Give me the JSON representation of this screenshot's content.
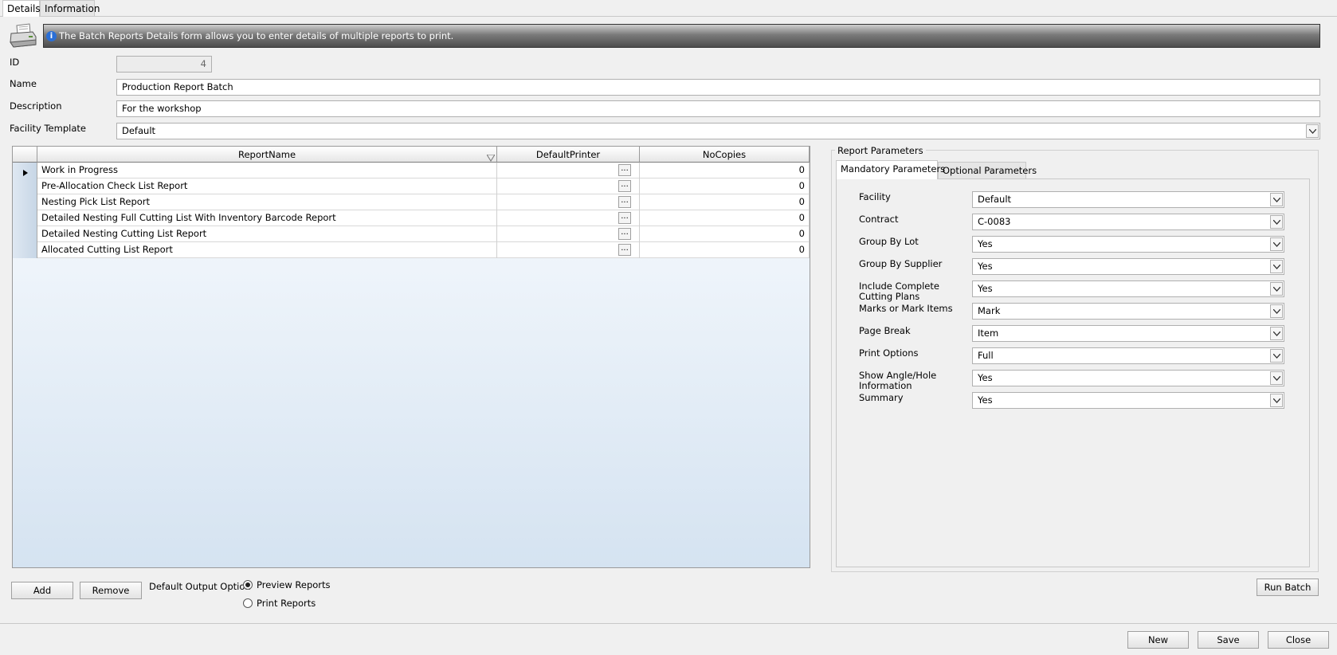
{
  "tabs": [
    "Details",
    "Information"
  ],
  "banner": {
    "text": "The Batch Reports Details form allows you to enter details of multiple reports to print."
  },
  "form": {
    "id_label": "ID",
    "id_value": "4",
    "name_label": "Name",
    "name_value": "Production Report Batch",
    "description_label": "Description",
    "description_value": "For the workshop",
    "facility_template_label": "Facility Template",
    "facility_template_value": "Default"
  },
  "grid": {
    "columns": [
      "ReportName",
      "DefaultPrinter",
      "NoCopies"
    ],
    "rows": [
      {
        "name": "Work in Progress",
        "printer": "",
        "copies": "0"
      },
      {
        "name": "Pre-Allocation Check List Report",
        "printer": "",
        "copies": "0"
      },
      {
        "name": "Nesting Pick List Report",
        "printer": "",
        "copies": "0"
      },
      {
        "name": "Detailed Nesting Full Cutting List With Inventory Barcode Report",
        "printer": "",
        "copies": "0"
      },
      {
        "name": "Detailed Nesting Cutting List Report",
        "printer": "",
        "copies": "0"
      },
      {
        "name": "Allocated Cutting List Report",
        "printer": "",
        "copies": "0"
      }
    ],
    "ellipsis": "..."
  },
  "actions": {
    "add": "Add",
    "remove": "Remove",
    "output_label": "Default Output Option",
    "preview": "Preview Reports",
    "print": "Print Reports",
    "run_batch": "Run Batch"
  },
  "params": {
    "group_title": "Report Parameters",
    "tabs": [
      "Mandatory Parameters",
      "Optional Parameters"
    ],
    "fields": [
      {
        "label": "Facility",
        "value": "Default"
      },
      {
        "label": "Contract",
        "value": "C-0083"
      },
      {
        "label": "Group By Lot",
        "value": "Yes"
      },
      {
        "label": "Group By Supplier",
        "value": "Yes"
      },
      {
        "label": "Include Complete Cutting Plans",
        "value": "Yes"
      },
      {
        "label": "Marks or Mark Items",
        "value": "Mark"
      },
      {
        "label": "Page Break",
        "value": "Item"
      },
      {
        "label": "Print Options",
        "value": "Full"
      },
      {
        "label": "Show Angle/Hole Information",
        "value": "Yes"
      },
      {
        "label": "Summary",
        "value": "Yes"
      }
    ]
  },
  "footer": {
    "new": "New",
    "save": "Save",
    "close": "Close"
  }
}
